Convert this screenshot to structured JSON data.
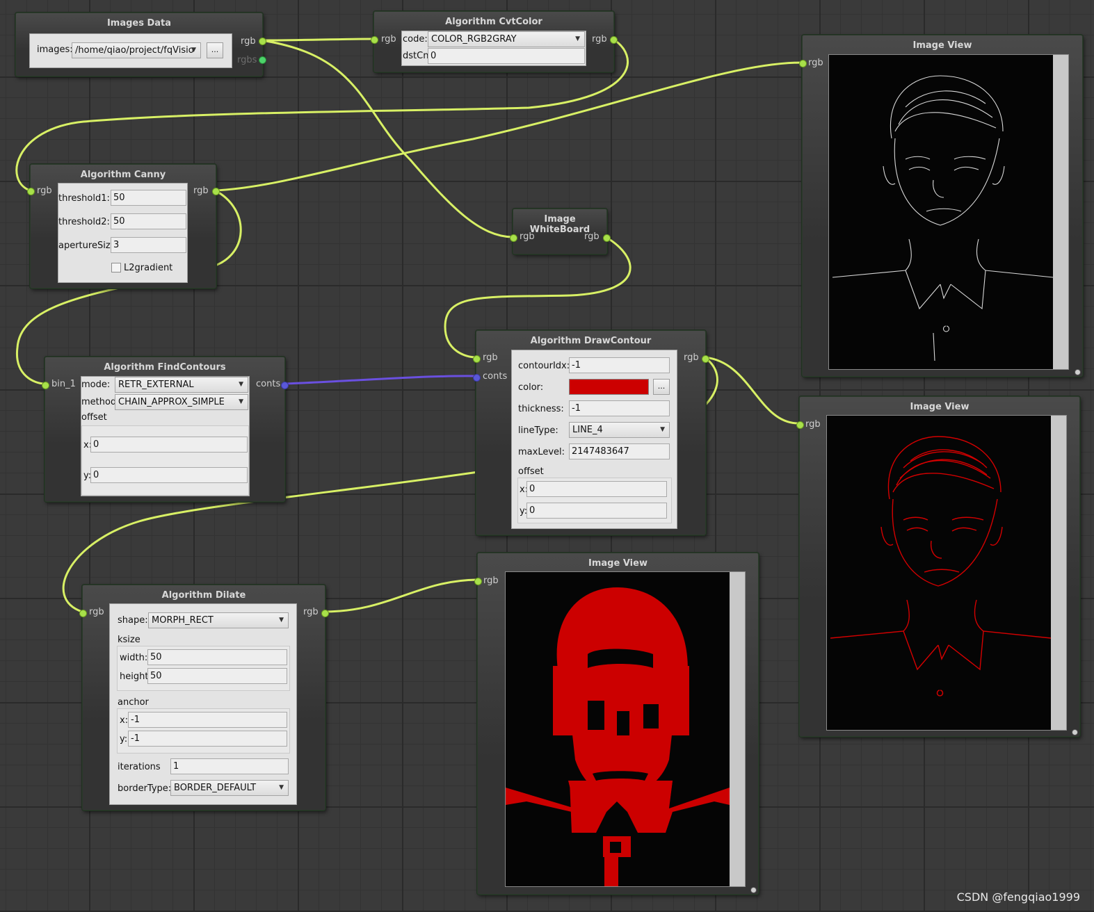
{
  "colors": {
    "wire": "#d8f065",
    "contour_wire": "#6a50e0",
    "contour_color": "#cc0000"
  },
  "images_data": {
    "title": "Images Data",
    "images_label": "images:",
    "images_value": "/home/qiao/project/fqVisio",
    "browse": "...",
    "out_rgb": "rgb",
    "out_rgbs": "rgbs"
  },
  "cvtcolor": {
    "title": "Algorithm CvtColor",
    "in_rgb": "rgb",
    "out_rgb": "rgb",
    "code_label": "code:",
    "code_value": "COLOR_RGB2GRAY",
    "dstcn_label": "dstCn:",
    "dstcn_value": "0"
  },
  "canny": {
    "title": "Algorithm Canny",
    "in_rgb": "rgb",
    "out_rgb": "rgb",
    "t1_label": "threshold1:",
    "t1_value": "50",
    "t2_label": "threshold2:",
    "t2_value": "50",
    "ap_label": "apertureSize:",
    "ap_value": "3",
    "l2_label": "L2gradient"
  },
  "whiteboard": {
    "title": "Image WhiteBoard",
    "in_rgb": "rgb",
    "out_rgb": "rgb"
  },
  "findcontours": {
    "title": "Algorithm FindContours",
    "in_bin": "bin_1",
    "out_conts": "conts",
    "mode_label": "mode:",
    "mode_value": "RETR_EXTERNAL",
    "method_label": "method:",
    "method_value": "CHAIN_APPROX_SIMPLE",
    "offset_label": "offset",
    "x_label": "x:",
    "x_value": "0",
    "y_label": "y:",
    "y_value": "0"
  },
  "drawcontour": {
    "title": "Algorithm DrawContour",
    "in_rgb": "rgb",
    "in_conts": "conts",
    "out_rgb": "rgb",
    "idx_label": "contourIdx:",
    "idx_value": "-1",
    "color_label": "color:",
    "color_btn": "...",
    "thick_label": "thickness:",
    "thick_value": "-1",
    "linetype_label": "lineType:",
    "linetype_value": "LINE_4",
    "maxlevel_label": "maxLevel:",
    "maxlevel_value": "2147483647",
    "offset_label": "offset",
    "x_label": "x:",
    "x_value": "0",
    "y_label": "y:",
    "y_value": "0"
  },
  "dilate": {
    "title": "Algorithm Dilate",
    "in_rgb": "rgb",
    "out_rgb": "rgb",
    "shape_label": "shape:",
    "shape_value": "MORPH_RECT",
    "ksize_label": "ksize",
    "width_label": "width:",
    "width_value": "50",
    "height_label": "height:",
    "height_value": "50",
    "anchor_label": "anchor",
    "ax_label": "x:",
    "ax_value": "-1",
    "ay_label": "y:",
    "ay_value": "-1",
    "iter_label": "iterations",
    "iter_value": "1",
    "border_label": "borderType:",
    "border_value": "BORDER_DEFAULT"
  },
  "view1": {
    "title": "Image View",
    "in_rgb": "rgb"
  },
  "view2": {
    "title": "Image View",
    "in_rgb": "rgb"
  },
  "view3": {
    "title": "Image View",
    "in_rgb": "rgb"
  },
  "watermark": "CSDN @fengqiao1999"
}
